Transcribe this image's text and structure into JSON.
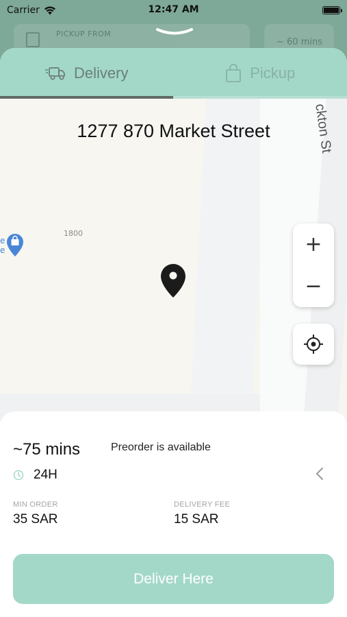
{
  "status_bar": {
    "carrier": "Carrier",
    "time": "12:47 AM"
  },
  "background": {
    "pickup_from_label": "PICKUP FROM",
    "eta_label": "~ 60 mins"
  },
  "tabs": [
    {
      "label": "Delivery",
      "icon": "delivery-truck-icon",
      "active": true
    },
    {
      "label": "Pickup",
      "icon": "shopping-bag-icon",
      "active": false
    }
  ],
  "map": {
    "address": "1277 870 Market Street",
    "street_label": "ckton St",
    "building_number": "1800",
    "poi_text_top": "e",
    "poi_text_bottom": "e",
    "zoom_in": "+",
    "zoom_out": "−"
  },
  "info": {
    "eta": "~75 mins",
    "preorder": "Preorder is available",
    "hours": "24H",
    "min_order_label": "MIN ORDER",
    "min_order_value": "35 SAR",
    "delivery_fee_label": "DELIVERY FEE",
    "delivery_fee_value": "15 SAR",
    "cta_label": "Deliver Here"
  },
  "colors": {
    "accent": "#a3d8c9",
    "indicator": "#606b68"
  }
}
